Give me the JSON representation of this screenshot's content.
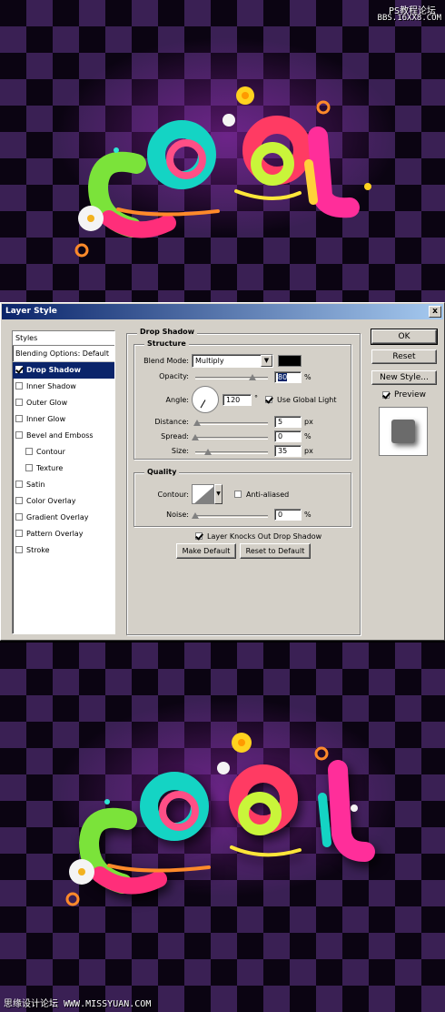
{
  "watermark_top": "PS教程论坛",
  "watermark_top_sub": "BBS.16XX8.COM",
  "watermark_bottom": "思缘设计论坛 WWW.MISSYUAN.COM",
  "artwork_text": "COOL",
  "dialog": {
    "title": "Layer Style",
    "close": "x",
    "styles_header": "Styles",
    "style_items": [
      {
        "label": "Blending Options: Default",
        "checked": false
      },
      {
        "label": "Drop Shadow",
        "checked": true
      },
      {
        "label": "Inner Shadow",
        "checked": false
      },
      {
        "label": "Outer Glow",
        "checked": false
      },
      {
        "label": "Inner Glow",
        "checked": false
      },
      {
        "label": "Bevel and Emboss",
        "checked": false
      },
      {
        "label": "Contour",
        "checked": false
      },
      {
        "label": "Texture",
        "checked": false
      },
      {
        "label": "Satin",
        "checked": false
      },
      {
        "label": "Color Overlay",
        "checked": false
      },
      {
        "label": "Gradient Overlay",
        "checked": false
      },
      {
        "label": "Pattern Overlay",
        "checked": false
      },
      {
        "label": "Stroke",
        "checked": false
      }
    ],
    "section_title": "Drop Shadow",
    "structure": {
      "title": "Structure",
      "blend_mode_label": "Blend Mode:",
      "blend_mode_value": "Multiply",
      "shadow_color": "#000000",
      "opacity_label": "Opacity:",
      "opacity_value": "80",
      "opacity_unit": "%",
      "opacity_level": 0.8,
      "angle_label": "Angle:",
      "angle_value": "120",
      "angle_unit": "°",
      "use_global_light_label": "Use Global Light",
      "use_global_light": true,
      "distance_label": "Distance:",
      "distance_value": "5",
      "distance_unit": "px",
      "spread_label": "Spread:",
      "spread_value": "0",
      "spread_unit": "%",
      "size_label": "Size:",
      "size_value": "35",
      "size_unit": "px"
    },
    "quality": {
      "title": "Quality",
      "contour_label": "Contour:",
      "anti_aliased_label": "Anti-aliased",
      "noise_label": "Noise:",
      "noise_value": "0",
      "noise_unit": "%"
    },
    "knockout_label": "Layer Knocks Out Drop Shadow",
    "make_default": "Make Default",
    "reset_default": "Reset to Default",
    "ok": "OK",
    "reset": "Reset",
    "new_style": "New Style...",
    "preview_label": "Preview"
  }
}
